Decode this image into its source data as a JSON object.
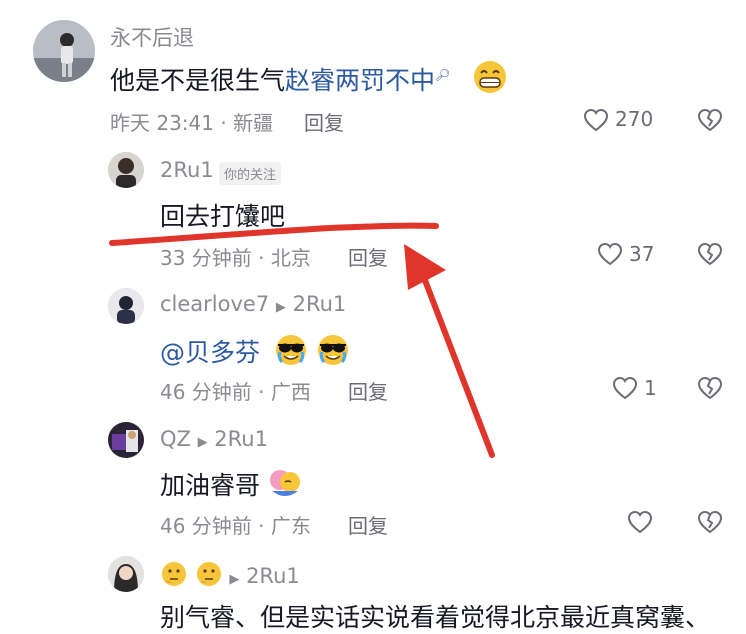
{
  "comments": [
    {
      "username": "永不后退",
      "content_prefix": "他是不是很生气",
      "content_link": "赵睿两罚不中",
      "time_location": "昨天 23:41 · 新疆",
      "reply_label": "回复",
      "likes": "270"
    },
    {
      "username": "2Ru1",
      "badge": "你的关注",
      "content": "回去打馕吧",
      "time_location": "33 分钟前 · 北京",
      "reply_label": "回复",
      "likes": "37"
    },
    {
      "username": "clearlove7",
      "reply_to": "2Ru1",
      "mention": "@贝多芬",
      "time_location": "46 分钟前 · 广西",
      "reply_label": "回复",
      "likes": "1"
    },
    {
      "username": "QZ",
      "reply_to": "2Ru1",
      "content": "加油睿哥",
      "time_location": "46 分钟前 · 广东",
      "reply_label": "回复",
      "likes": ""
    },
    {
      "reply_to": "2Ru1",
      "content": "别气睿、但是实话实说看着觉得北京最近真窝囊、"
    }
  ],
  "colors": {
    "annotation_red": "#e0352b",
    "link_blue": "#2c5aa0",
    "meta_gray": "#8a8b91"
  }
}
